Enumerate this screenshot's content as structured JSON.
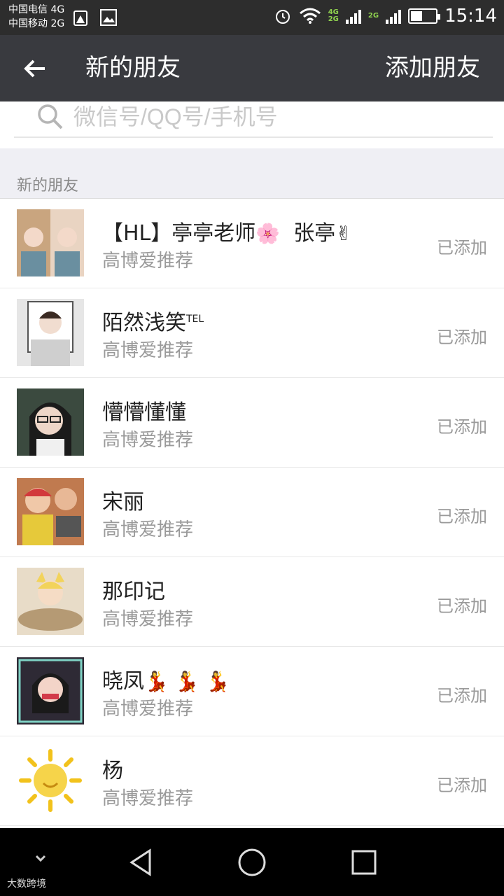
{
  "status_bar": {
    "carrier1": "中国电信 4G",
    "carrier2": "中国移动 2G",
    "net1": "4G",
    "net2": "2G",
    "net3": "2G",
    "time": "15:14",
    "battery_level": 0.45
  },
  "header": {
    "title": "新的朋友",
    "action": "添加朋友"
  },
  "search": {
    "placeholder": "微信号/QQ号/手机号"
  },
  "section": {
    "label": "新的朋友"
  },
  "friends": [
    {
      "name": "【HL】亭亭老师",
      "name_suffix": "张亭",
      "emoji1": "🌸",
      "emoji2": "✌",
      "subtitle": "高博爱推荐",
      "status": "已添加",
      "avatar_color": "#c9a57f"
    },
    {
      "name": "陌然浅笑",
      "tel": "TEL",
      "subtitle": "高博爱推荐",
      "status": "已添加",
      "avatar_color": "#d9d9d9"
    },
    {
      "name": "懵懵懂懂",
      "subtitle": "高博爱推荐",
      "status": "已添加",
      "avatar_color": "#3b4a3f"
    },
    {
      "name": "宋丽",
      "subtitle": "高博爱推荐",
      "status": "已添加",
      "avatar_color": "#c07a4f"
    },
    {
      "name": "那印记",
      "subtitle": "高博爱推荐",
      "status": "已添加",
      "avatar_color": "#d2b68e"
    },
    {
      "name": "晓凤",
      "emoji": "💃 💃 💃",
      "subtitle": "高博爱推荐",
      "status": "已添加",
      "avatar_color": "#2e2a35"
    },
    {
      "name": "杨",
      "subtitle": "高博爱推荐",
      "status": "已添加",
      "avatar_color": "#f6d44a"
    }
  ],
  "watermark": "大数跨境"
}
